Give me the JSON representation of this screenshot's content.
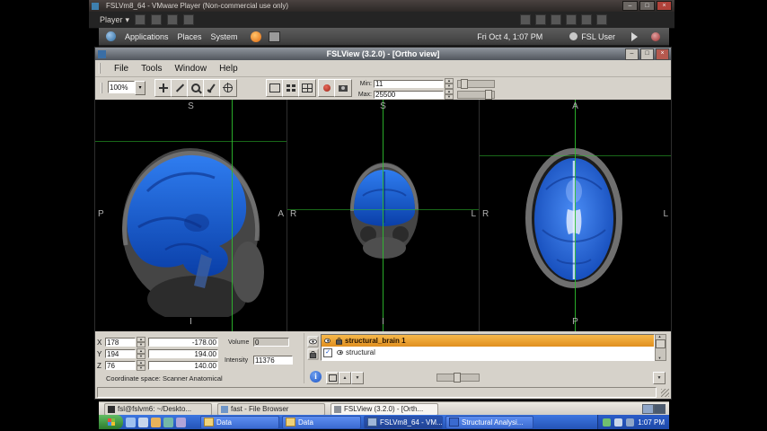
{
  "icons": {
    "minimize": "–",
    "maximize": "□",
    "close": "×",
    "caret_down": "▾",
    "spin_up": "▲",
    "spin_down": "▼",
    "info": "i",
    "check": "✓"
  },
  "vmware": {
    "title": "FSLVm8_64 - VMware Player (Non-commercial use only)",
    "player_menu": "Player"
  },
  "gnome_panel": {
    "menus": [
      "Applications",
      "Places",
      "System"
    ],
    "clock": "Fri Oct 4,  1:07 PM",
    "user": "FSL User"
  },
  "fslview": {
    "title": "FSLView (3.2.0) - [Ortho view]",
    "menus": [
      "File",
      "Tools",
      "Window",
      "Help"
    ],
    "toolbar": {
      "zoom": "100%",
      "min_label": "Min:",
      "max_label": "Max:",
      "min_value": "11",
      "max_value": "25500"
    },
    "views": [
      {
        "name": "sagittal",
        "top": "S",
        "bottom": "I",
        "left": "P",
        "right": "A"
      },
      {
        "name": "coronal",
        "top": "S",
        "bottom": "I",
        "left": "R",
        "right": "L"
      },
      {
        "name": "axial",
        "top": "A",
        "bottom": "P",
        "left": "R",
        "right": "L"
      }
    ],
    "coords": {
      "rows": [
        {
          "axis": "X",
          "voxel": "178",
          "mm": "-178.00"
        },
        {
          "axis": "Y",
          "voxel": "194",
          "mm": "194.00"
        },
        {
          "axis": "Z",
          "voxel": "76",
          "mm": "140.00"
        }
      ],
      "volume_label": "Volume",
      "volume_value": "0",
      "intensity_label": "Intensity",
      "intensity_value": "11376",
      "space_text": "Coordinate space: Scanner Anatomical"
    },
    "layers": [
      {
        "name": "structural_brain 1"
      },
      {
        "name": "structural"
      }
    ]
  },
  "gnome_taskbar": {
    "buttons": [
      "fsl@fslvm6: ~/Deskto...",
      "fast - File Browser",
      "FSLView (3.2.0) - [Orth..."
    ]
  },
  "win_taskbar": {
    "buttons": [
      "Data",
      "Data",
      "FSLVm8_64 - VM...",
      "Structural Analysi..."
    ],
    "clock": "1:07 PM"
  }
}
